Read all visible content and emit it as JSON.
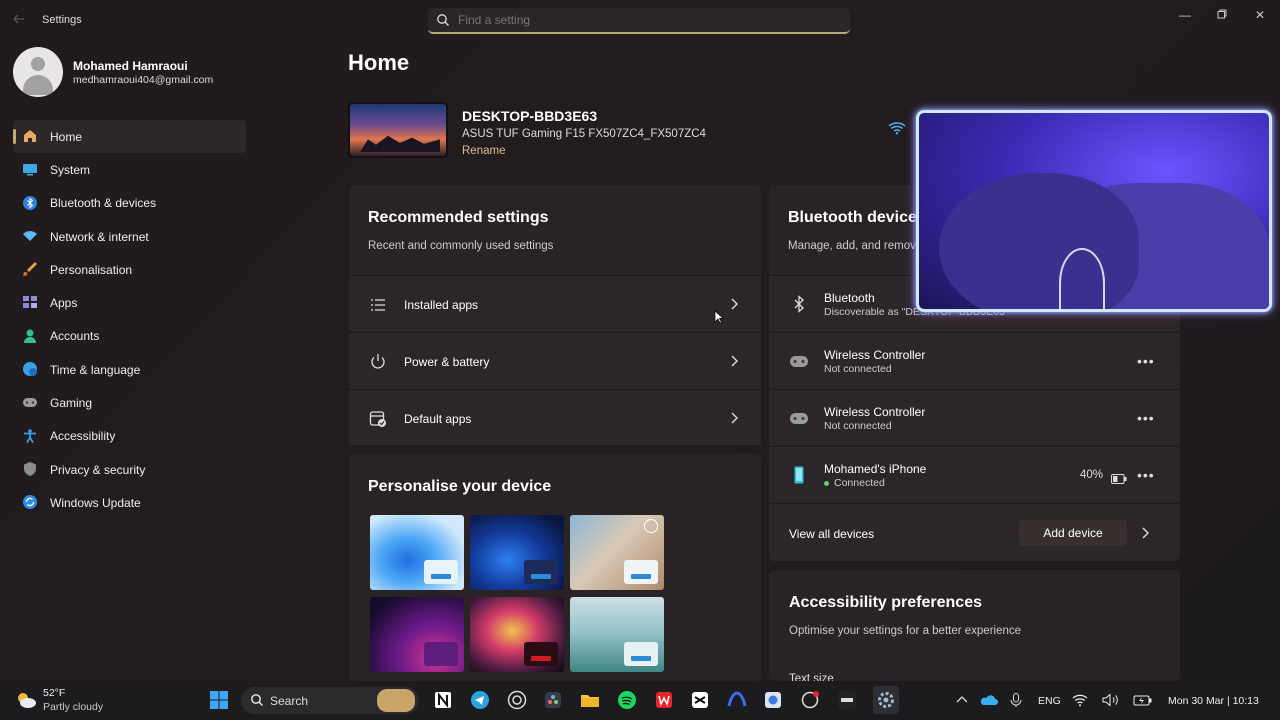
{
  "window": {
    "title": "Settings",
    "search_placeholder": "Find a setting"
  },
  "profile": {
    "name": "Mohamed Hamraoui",
    "email": "medhamraoui404@gmail.com"
  },
  "nav": {
    "items": [
      {
        "label": "Home",
        "icon": "home-icon",
        "active": true
      },
      {
        "label": "System",
        "icon": "system-icon"
      },
      {
        "label": "Bluetooth & devices",
        "icon": "bluetooth-icon"
      },
      {
        "label": "Network & internet",
        "icon": "wifi-icon"
      },
      {
        "label": "Personalisation",
        "icon": "brush-icon"
      },
      {
        "label": "Apps",
        "icon": "apps-icon"
      },
      {
        "label": "Accounts",
        "icon": "accounts-icon"
      },
      {
        "label": "Time & language",
        "icon": "globe-clock-icon"
      },
      {
        "label": "Gaming",
        "icon": "gamepad-icon"
      },
      {
        "label": "Accessibility",
        "icon": "accessibility-icon"
      },
      {
        "label": "Privacy & security",
        "icon": "shield-icon"
      },
      {
        "label": "Windows Update",
        "icon": "update-icon"
      }
    ]
  },
  "main": {
    "title": "Home",
    "device": {
      "name": "DESKTOP-BBD3E63",
      "model": "ASUS TUF Gaming F15 FX507ZC4_FX507ZC4",
      "rename_label": "Rename"
    },
    "recommended": {
      "title": "Recommended settings",
      "subtitle": "Recent and commonly used settings",
      "items": [
        {
          "label": "Installed apps",
          "icon": "list-icon"
        },
        {
          "label": "Power & battery",
          "icon": "power-icon"
        },
        {
          "label": "Default apps",
          "icon": "default-apps-icon"
        }
      ]
    },
    "personalise": {
      "title": "Personalise your device"
    },
    "bluetooth": {
      "title": "Bluetooth devices",
      "subtitle": "Manage, add, and remove",
      "devices": [
        {
          "name": "Bluetooth",
          "status": "Discoverable as \"DESKTOP-BBD3E63\"",
          "icon": "bluetooth-icon"
        },
        {
          "name": "Wireless Controller",
          "status": "Not connected",
          "icon": "gamepad-icon"
        },
        {
          "name": "Wireless Controller",
          "status": "Not connected",
          "icon": "gamepad-icon"
        },
        {
          "name": "Mohamed's iPhone",
          "status": "Connected",
          "battery": "40%",
          "icon": "phone-icon"
        }
      ],
      "view_all_label": "View all devices",
      "add_device_label": "Add device"
    },
    "accessibility": {
      "title": "Accessibility preferences",
      "subtitle": "Optimise your settings for a better experience",
      "first_item": "Text size"
    }
  },
  "taskbar": {
    "weather_temp": "52°F",
    "weather_desc": "Partly cloudy",
    "search_label": "Search",
    "language": "ENG",
    "datetime": "Mon 30 Mar | 10:13"
  },
  "colors": {
    "accent": "#c4a972",
    "background": "#201b1d",
    "card": "#2a2326"
  }
}
